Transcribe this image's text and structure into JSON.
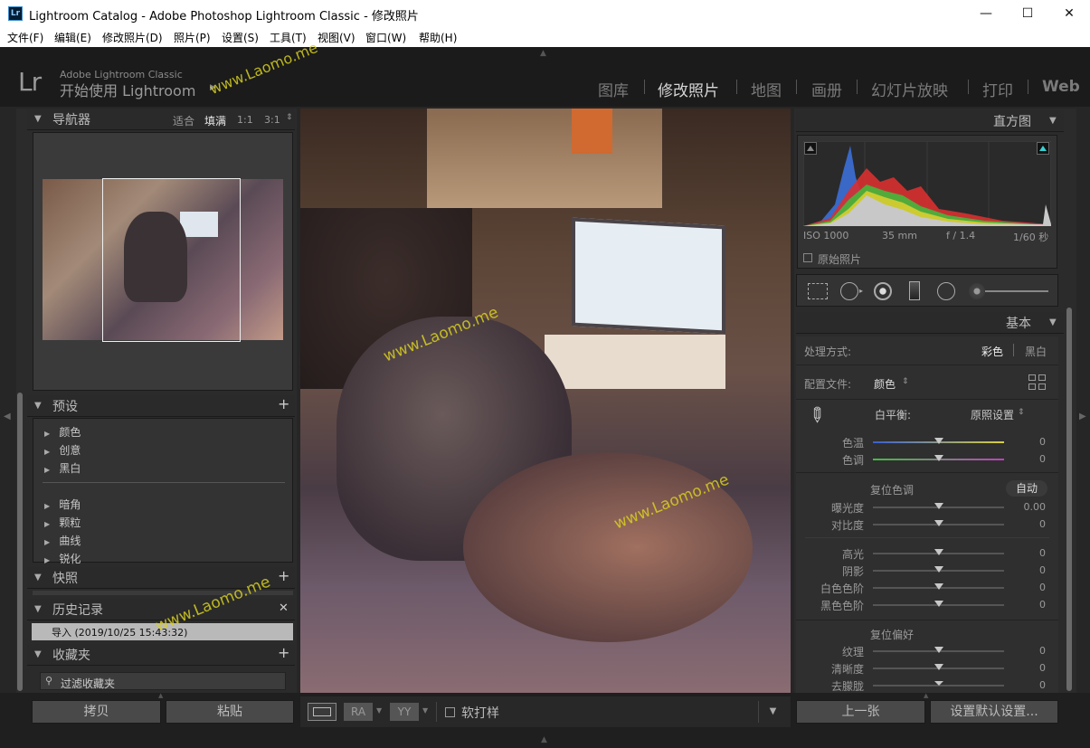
{
  "window": {
    "title": "Lightroom Catalog - Adobe Photoshop Lightroom Classic - 修改照片",
    "app_icon": "Lr",
    "minimize": "—",
    "maximize": "☐",
    "close": "✕"
  },
  "menu": [
    "文件(F)",
    "编辑(E)",
    "修改照片(D)",
    "照片(P)",
    "设置(S)",
    "工具(T)",
    "视图(V)",
    "窗口(W)",
    "帮助(H)"
  ],
  "identity": {
    "logo": "Lr",
    "line1": "Adobe Lightroom Classic",
    "line2": "开始使用 Lightroom",
    "arrow": "▶"
  },
  "modules": [
    "图库",
    "修改照片",
    "地图",
    "画册",
    "幻灯片放映",
    "打印",
    "Web"
  ],
  "active_module": "修改照片",
  "watermark": "www.Laomo.me",
  "navigator": {
    "title": "导航器",
    "zoom": [
      "适合",
      "填满",
      "1:1",
      "3:1"
    ],
    "zoom_active": "填满"
  },
  "presets": {
    "title": "预设",
    "add": "+",
    "group1": [
      "颜色",
      "创意",
      "黑白"
    ],
    "group2": [
      "暗角",
      "颗粒",
      "曲线",
      "锐化"
    ]
  },
  "snapshots": {
    "title": "快照",
    "add": "+"
  },
  "history": {
    "title": "历史记录",
    "close": "✕",
    "items": [
      "导入 (2019/10/25 15:43:32)"
    ]
  },
  "collections": {
    "title": "收藏夹",
    "add": "+",
    "filter": "过滤收藏夹"
  },
  "left_buttons": {
    "copy": "拷贝",
    "paste": "粘贴"
  },
  "toolbar": {
    "view1": "RA",
    "view2": "YY",
    "softproof": "软打样"
  },
  "histogram": {
    "title": "直方图",
    "iso": "ISO 1000",
    "focal": "35 mm",
    "aperture": "f / 1.4",
    "shutter": "1/60 秒",
    "original": "原始照片"
  },
  "basic": {
    "title": "基本",
    "treatment_label": "处理方式:",
    "treatment_color": "彩色",
    "treatment_bw": "黑白",
    "profile_label": "配置文件:",
    "profile_value": "颜色",
    "wb_label": "白平衡:",
    "wb_value": "原照设置",
    "temp_label": "色温",
    "temp_value": "0",
    "tint_label": "色调",
    "tint_value": "0",
    "tone_label": "复位色调",
    "auto": "自动",
    "exposure_label": "曝光度",
    "exposure_value": "0.00",
    "contrast_label": "对比度",
    "contrast_value": "0",
    "highlights_label": "高光",
    "highlights_value": "0",
    "shadows_label": "阴影",
    "shadows_value": "0",
    "whites_label": "白色色阶",
    "whites_value": "0",
    "blacks_label": "黑色色阶",
    "blacks_value": "0",
    "presence_label": "复位偏好",
    "texture_label": "纹理",
    "texture_value": "0",
    "clarity_label": "清晰度",
    "clarity_value": "0",
    "dehaze_label": "去朦胧",
    "dehaze_value": "0"
  },
  "right_buttons": {
    "previous": "上一张",
    "reset": "设置默认设置..."
  }
}
